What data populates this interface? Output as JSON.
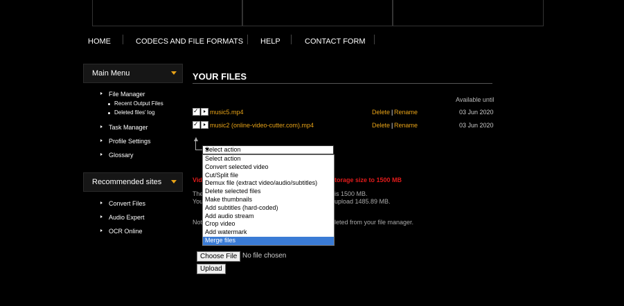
{
  "nav": {
    "home": "HOME",
    "codecs": "CODECS AND FILE FORMATS",
    "help": "HELP",
    "contact": "CONTACT FORM"
  },
  "sidebar": {
    "main_menu": "Main Menu",
    "items": [
      "File Manager",
      "Task Manager",
      "Profile Settings",
      "Glossary"
    ],
    "sub_items": [
      "Recent Output Files",
      "Deleted files' log"
    ],
    "recommended": "Recommended sites",
    "sites": [
      "Convert Files",
      "Audio Expert",
      "OCR Online"
    ]
  },
  "main": {
    "title": "YOUR FILES",
    "available_until": "Available until",
    "files": [
      {
        "name": "music5.mp4",
        "delete": "Delete",
        "sep": "|",
        "rename": "Rename",
        "date": "03 Jun 2020"
      },
      {
        "name": "music2 (online-video-cutter.com).mp4",
        "delete": "Delete",
        "sep": "|",
        "rename": "Rename",
        "date": "03 Jun 2020"
      }
    ],
    "partial_red_left": "Vid",
    "partial_red_right": "torage size to 1500 MB",
    "partial_line1_left": "The",
    "partial_line1_right": "is 1500 MB.",
    "partial_line2_left": "You",
    "partial_line2_right": "upload 1485.89 MB.",
    "partial_line3_left": "Not",
    "partial_line3_right": "leted from your file manager.",
    "no_file": "No file chosen",
    "choose_file": "Choose File",
    "upload": "Upload"
  },
  "action_select": {
    "selected": "Select action",
    "options": [
      "Select action",
      "Convert selected video",
      "Cut/Split file",
      "Demux file (extract video/audio/subtitles)",
      "Delete selected files",
      "Make thumbnails",
      "Add subtitles (hard-coded)",
      "Add audio stream",
      "Crop video",
      "Add watermark",
      "Merge files"
    ],
    "highlighted_index": 10
  },
  "colors": {
    "accent": "#e8a317",
    "warning": "#e21b1b",
    "highlight": "#3a7bd5"
  }
}
